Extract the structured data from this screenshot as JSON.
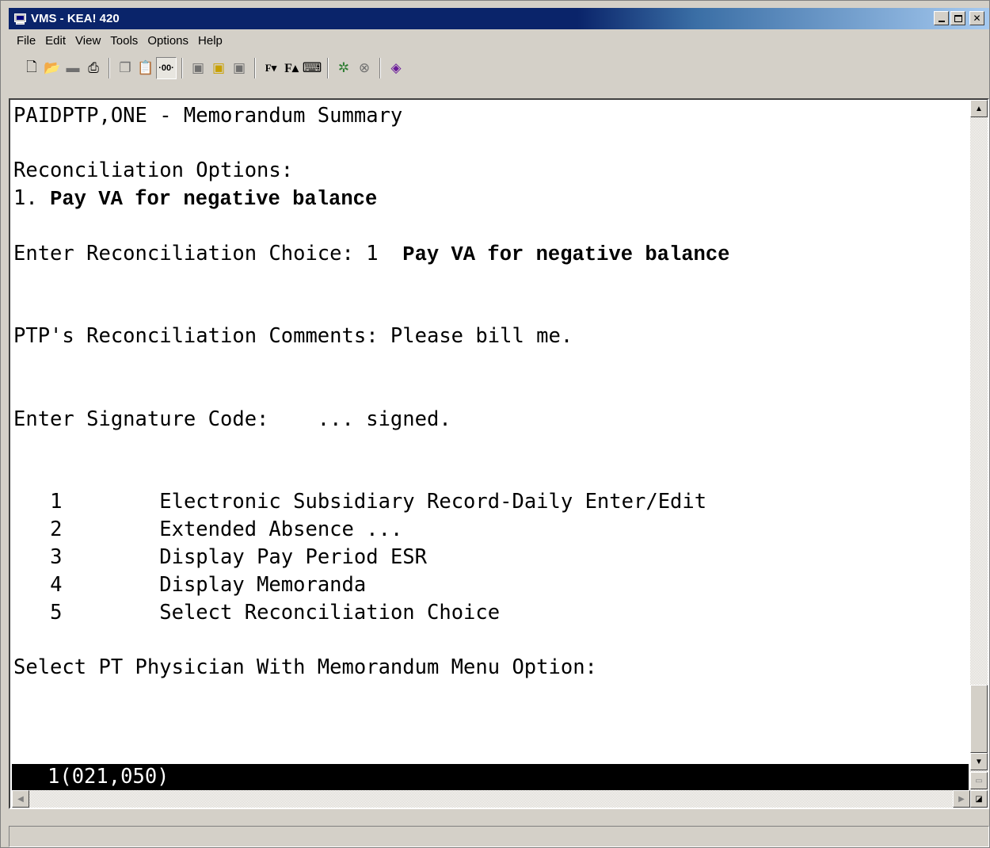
{
  "window": {
    "title": "VMS - KEA! 420",
    "controls": [
      "minimize",
      "maximize",
      "close"
    ]
  },
  "menu": [
    "File",
    "Edit",
    "View",
    "Tools",
    "Options",
    "Help"
  ],
  "toolbar": {
    "groups": [
      [
        "new-icon",
        "open-folder-icon",
        "save-icon",
        "print-icon"
      ],
      [
        "copy-icon",
        "paste-icon",
        "zoom-mode-icon"
      ],
      [
        "receive-file-icon",
        "send-file-icon",
        "transfer-icon"
      ],
      [
        "font-decrease-icon",
        "font-increase-icon",
        "keyboard-icon"
      ],
      [
        "network-icon",
        "disconnect-icon"
      ],
      [
        "help-book-icon"
      ]
    ]
  },
  "terminal": {
    "header": "PAIDPTP,ONE - Memorandum Summary",
    "recon_label": "Reconciliation Options:",
    "option1_num": "1.",
    "option1_text": "Pay VA for negative balance",
    "choice_prompt": "Enter Reconciliation Choice: 1",
    "choice_value": "Pay VA for negative balance",
    "comments": "PTP's Reconciliation Comments: Please bill me.",
    "signature": "Enter Signature Code:    ... signed.",
    "menu_items": [
      {
        "num": "1",
        "label": "Electronic Subsidiary Record-Daily Enter/Edit"
      },
      {
        "num": "2",
        "label": "Extended Absence ..."
      },
      {
        "num": "3",
        "label": "Display Pay Period ESR"
      },
      {
        "num": "4",
        "label": "Display Memoranda"
      },
      {
        "num": "5",
        "label": "Select Reconciliation Choice"
      }
    ],
    "select_prompt": "Select PT Physician With Memorandum Menu Option:",
    "status_line": "1(021,050)"
  }
}
